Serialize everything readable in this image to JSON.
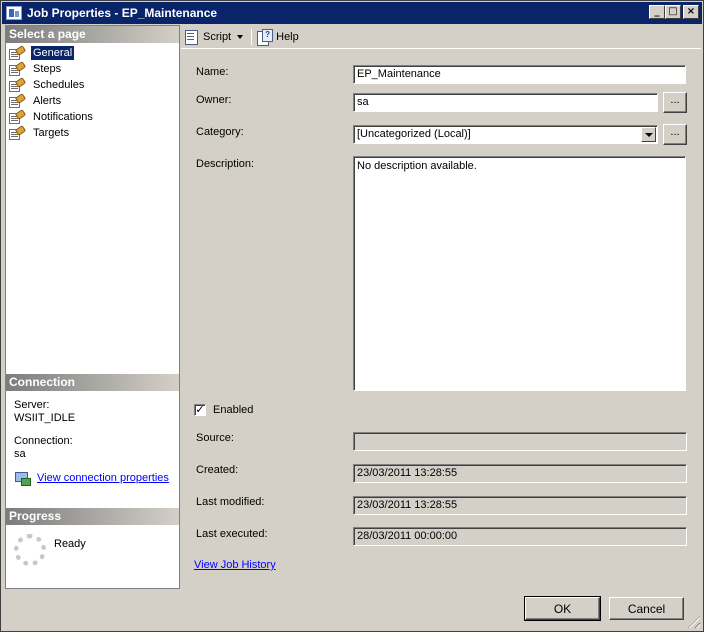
{
  "window": {
    "title": "Job Properties - EP_Maintenance",
    "controls": [
      "_",
      "□",
      "×"
    ]
  },
  "left_pane": {
    "select_page_header": "Select a page",
    "pages": [
      {
        "label": "General",
        "selected": true
      },
      {
        "label": "Steps",
        "selected": false
      },
      {
        "label": "Schedules",
        "selected": false
      },
      {
        "label": "Alerts",
        "selected": false
      },
      {
        "label": "Notifications",
        "selected": false
      },
      {
        "label": "Targets",
        "selected": false
      }
    ],
    "connection_header": "Connection",
    "server_label": "Server:",
    "server_value": "WSIIT_IDLE",
    "connection_label": "Connection:",
    "connection_value": "sa",
    "view_connection_link": "View connection properties",
    "progress_header": "Progress",
    "progress_status": "Ready"
  },
  "toolbar": {
    "script_label": "Script",
    "help_label": "Help"
  },
  "form": {
    "name_label": "Name:",
    "name_value": "EP_Maintenance",
    "owner_label": "Owner:",
    "owner_value": "sa",
    "browse_label": "...",
    "category_label": "Category:",
    "category_value": "[Uncategorized (Local)]",
    "description_label": "Description:",
    "description_value": "No description available.",
    "enabled_label": "Enabled",
    "enabled_checked": true,
    "source_label": "Source:",
    "source_value": "",
    "created_label": "Created:",
    "created_value": "23/03/2011 13:28:55",
    "last_modified_label": "Last modified:",
    "last_modified_value": "23/03/2011 13:28:55",
    "last_executed_label": "Last executed:",
    "last_executed_value": "28/03/2011 00:00:00",
    "view_history_link": "View Job History"
  },
  "footer": {
    "ok_label": "OK",
    "cancel_label": "Cancel"
  }
}
